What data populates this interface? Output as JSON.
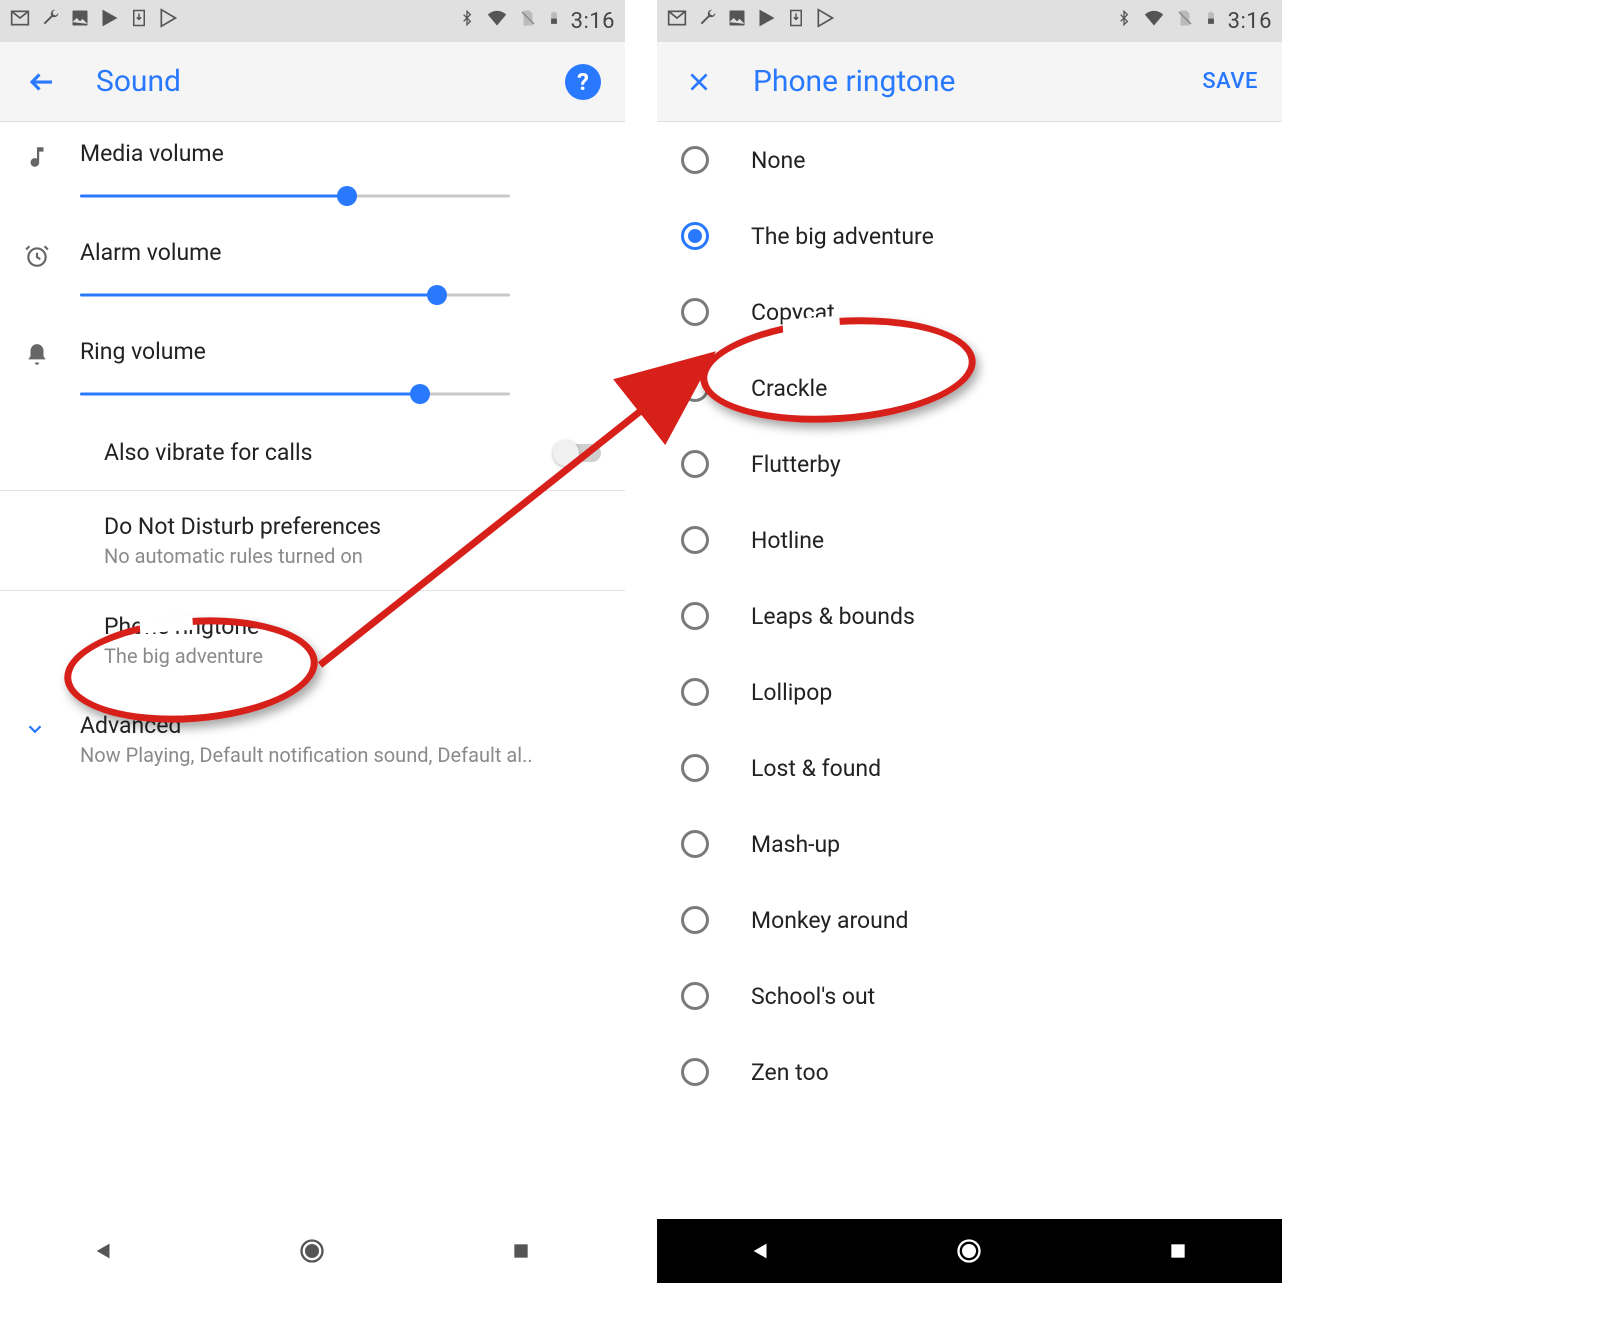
{
  "status": {
    "time": "3:16"
  },
  "left": {
    "title": "Sound",
    "sliders": [
      {
        "label": "Media volume",
        "percent": 62
      },
      {
        "label": "Alarm volume",
        "percent": 83
      },
      {
        "label": "Ring volume",
        "percent": 79
      }
    ],
    "vibrate": {
      "label": "Also vibrate for calls",
      "on": false
    },
    "dnd": {
      "title": "Do Not Disturb preferences",
      "sub": "No automatic rules turned on"
    },
    "ringtone": {
      "title": "Phone ringtone",
      "sub": "The big adventure"
    },
    "advanced": {
      "title": "Advanced",
      "sub": "Now Playing, Default notification sound, Default al.."
    }
  },
  "right": {
    "title": "Phone ringtone",
    "save": "SAVE",
    "items": [
      {
        "label": "None",
        "selected": false
      },
      {
        "label": "The big adventure",
        "selected": true
      },
      {
        "label": "Copycat",
        "selected": false
      },
      {
        "label": "Crackle",
        "selected": false
      },
      {
        "label": "Flutterby",
        "selected": false
      },
      {
        "label": "Hotline",
        "selected": false
      },
      {
        "label": "Leaps & bounds",
        "selected": false
      },
      {
        "label": "Lollipop",
        "selected": false
      },
      {
        "label": "Lost & found",
        "selected": false
      },
      {
        "label": "Mash-up",
        "selected": false
      },
      {
        "label": "Monkey around",
        "selected": false
      },
      {
        "label": "School's out",
        "selected": false
      },
      {
        "label": "Zen too",
        "selected": false
      }
    ]
  },
  "annotation": {
    "highlighted_left": "Phone ringtone",
    "highlighted_right": "Crackle",
    "arrow_from": "Phone ringtone",
    "arrow_to": "Crackle",
    "color": "#d8201a"
  }
}
